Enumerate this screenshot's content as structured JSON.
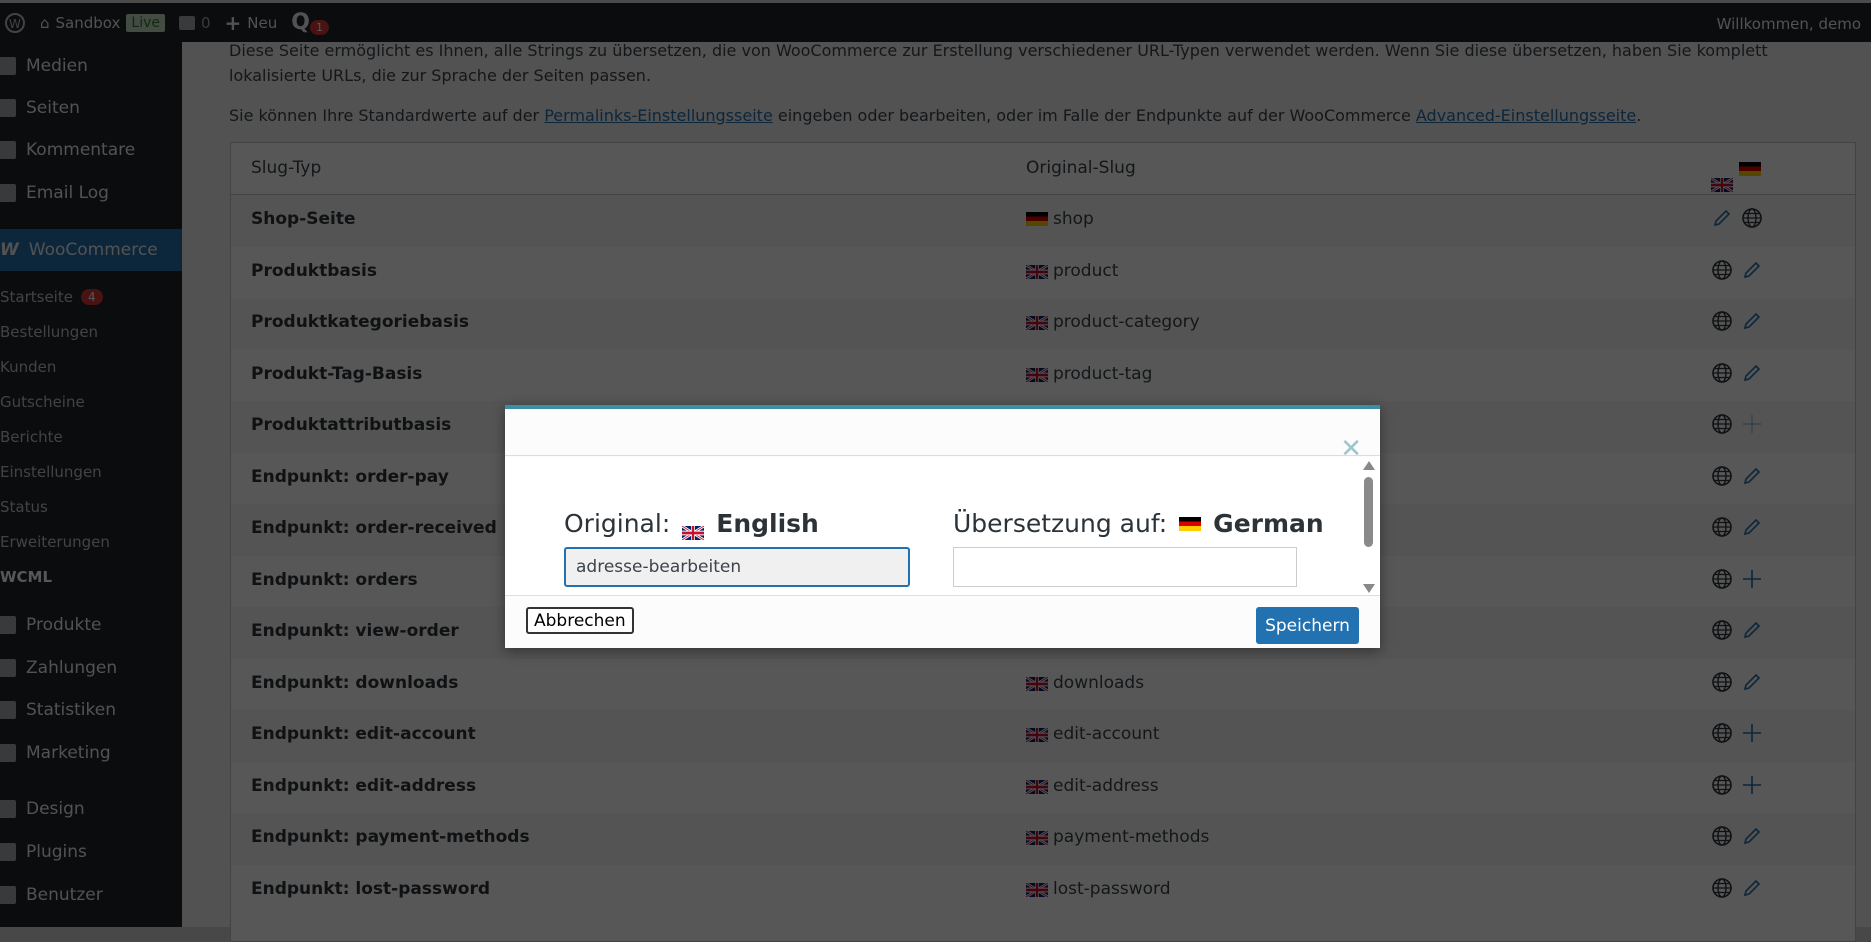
{
  "adminbar": {
    "site": "Sandbox",
    "live": "Live",
    "comments": "0",
    "new": "Neu",
    "notifications": "1",
    "welcome": "Willkommen, demo"
  },
  "sidebar": {
    "items": [
      {
        "label": "Medien"
      },
      {
        "label": "Seiten"
      },
      {
        "label": "Kommentare"
      },
      {
        "label": "Email Log"
      },
      {
        "label": "WooCommerce"
      }
    ],
    "sub": [
      {
        "label": "Startseite",
        "badge": "4"
      },
      {
        "label": "Bestellungen"
      },
      {
        "label": "Kunden"
      },
      {
        "label": "Gutscheine"
      },
      {
        "label": "Berichte"
      },
      {
        "label": "Einstellungen"
      },
      {
        "label": "Status"
      },
      {
        "label": "Erweiterungen"
      },
      {
        "label": "WCML"
      }
    ],
    "items2": [
      {
        "label": "Produkte"
      },
      {
        "label": "Zahlungen"
      },
      {
        "label": "Statistiken"
      },
      {
        "label": "Marketing"
      },
      {
        "label": "Design"
      },
      {
        "label": "Plugins"
      },
      {
        "label": "Benutzer"
      }
    ]
  },
  "content": {
    "intro": "Diese Seite ermöglicht es Ihnen, alle Strings zu übersetzen, die von WooCommerce zur Erstellung verschiedener URL-Typen verwendet werden. Wenn Sie diese übersetzen, haben Sie komplett lokalisierte URLs, die zur Sprache der Seiten passen.",
    "p2_a": "Sie können Ihre Standardwerte auf der ",
    "p2_link1": "Permalinks-Einstellungsseite",
    "p2_b": " eingeben oder bearbeiten, oder im Falle der Endpunkte auf der WooCommerce ",
    "p2_link2": "Advanced-Einstellungsseite",
    "p2_c": "."
  },
  "table": {
    "headers": [
      "Slug-Typ",
      "Original-Slug"
    ],
    "rows": [
      {
        "type": "Shop-Seite",
        "flag": "de",
        "slug": "shop",
        "icons": [
          "pencil",
          "globe"
        ]
      },
      {
        "type": "Produktbasis",
        "flag": "en",
        "slug": "product",
        "icons": [
          "globe",
          "pencil"
        ]
      },
      {
        "type": "Produktkategoriebasis",
        "flag": "en",
        "slug": "product-category",
        "icons": [
          "globe",
          "pencil"
        ]
      },
      {
        "type": "Produkt-Tag-Basis",
        "flag": "en",
        "slug": "product-tag",
        "icons": [
          "globe",
          "pencil"
        ]
      },
      {
        "type": "Produktattributbasis",
        "flag": "",
        "slug": "",
        "icons": [
          "globe",
          "plus-faint"
        ]
      },
      {
        "type": "Endpunkt: order-pay",
        "flag": "",
        "slug": "",
        "icons": [
          "globe",
          "pencil"
        ]
      },
      {
        "type": "Endpunkt: order-received",
        "flag": "",
        "slug": "",
        "icons": [
          "globe",
          "pencil"
        ]
      },
      {
        "type": "Endpunkt: orders",
        "flag": "",
        "slug": "",
        "icons": [
          "globe",
          "plus"
        ]
      },
      {
        "type": "Endpunkt: view-order",
        "flag": "",
        "slug": "",
        "icons": [
          "globe",
          "pencil"
        ]
      },
      {
        "type": "Endpunkt: downloads",
        "flag": "en",
        "slug": "downloads",
        "icons": [
          "globe",
          "pencil"
        ]
      },
      {
        "type": "Endpunkt: edit-account",
        "flag": "en",
        "slug": "edit-account",
        "icons": [
          "globe",
          "plus"
        ]
      },
      {
        "type": "Endpunkt: edit-address",
        "flag": "en",
        "slug": "edit-address",
        "icons": [
          "globe",
          "plus"
        ]
      },
      {
        "type": "Endpunkt: payment-methods",
        "flag": "en",
        "slug": "payment-methods",
        "icons": [
          "globe",
          "pencil"
        ]
      },
      {
        "type": "Endpunkt: lost-password",
        "flag": "en",
        "slug": "lost-password",
        "icons": [
          "globe",
          "pencil"
        ]
      }
    ]
  },
  "modal": {
    "original_label": "Original:",
    "original_lang": "English",
    "translation_label": "Übersetzung auf:",
    "translation_lang": "German",
    "original_value": "adresse-bearbeiten",
    "translation_value": "",
    "cancel": "Abbrechen",
    "save": "Speichern",
    "accent": "#3a8ea5"
  }
}
